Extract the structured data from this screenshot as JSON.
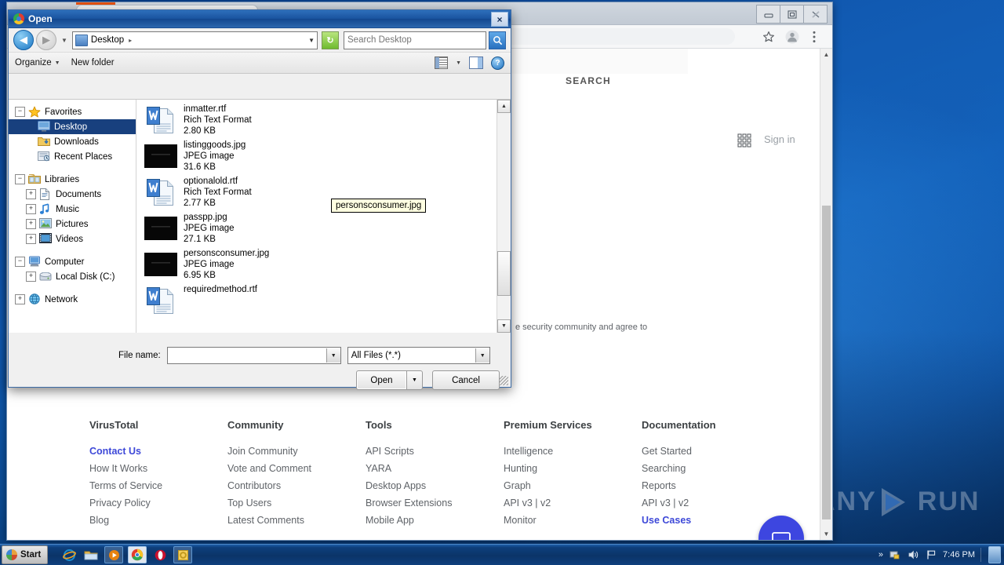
{
  "desktop": {
    "watermark": "ANY RUN",
    "watermark_left": "ANY",
    "watermark_right": "RUN"
  },
  "browser": {
    "window_controls": [
      "minimize",
      "maximize",
      "close"
    ],
    "toolbar_icons": [
      "star-icon",
      "avatar-icon",
      "menu-icon"
    ]
  },
  "vt_page": {
    "search_label": "SEARCH",
    "sign_in": "Sign in",
    "agree_text": "e security community and agree to",
    "footer": {
      "columns": [
        {
          "title": "VirusTotal",
          "links": [
            {
              "label": "Contact Us",
              "highlight": true
            },
            {
              "label": "How It Works",
              "highlight": false
            },
            {
              "label": "Terms of Service",
              "highlight": false
            },
            {
              "label": "Privacy Policy",
              "highlight": false
            },
            {
              "label": "Blog",
              "highlight": false
            }
          ]
        },
        {
          "title": "Community",
          "links": [
            {
              "label": "Join Community",
              "highlight": false
            },
            {
              "label": "Vote and Comment",
              "highlight": false
            },
            {
              "label": "Contributors",
              "highlight": false
            },
            {
              "label": "Top Users",
              "highlight": false
            },
            {
              "label": "Latest Comments",
              "highlight": false
            }
          ]
        },
        {
          "title": "Tools",
          "links": [
            {
              "label": "API Scripts",
              "highlight": false
            },
            {
              "label": "YARA",
              "highlight": false
            },
            {
              "label": "Desktop Apps",
              "highlight": false
            },
            {
              "label": "Browser Extensions",
              "highlight": false
            },
            {
              "label": "Mobile App",
              "highlight": false
            }
          ]
        },
        {
          "title": "Premium Services",
          "links": [
            {
              "label": "Intelligence",
              "highlight": false
            },
            {
              "label": "Hunting",
              "highlight": false
            },
            {
              "label": "Graph",
              "highlight": false
            },
            {
              "label": "API v3 | v2",
              "highlight": false
            },
            {
              "label": "Monitor",
              "highlight": false
            }
          ]
        },
        {
          "title": "Documentation",
          "links": [
            {
              "label": "Get Started",
              "highlight": false
            },
            {
              "label": "Searching",
              "highlight": false
            },
            {
              "label": "Reports",
              "highlight": false
            },
            {
              "label": "API v3 | v2",
              "highlight": false
            },
            {
              "label": "Use Cases",
              "highlight": true
            }
          ]
        }
      ]
    }
  },
  "dialog": {
    "title": "Open",
    "close_label": "×",
    "address": {
      "crumb": "Desktop",
      "crumb_arrow": "▸",
      "dropdown": "▼",
      "refresh": "↻"
    },
    "search": {
      "placeholder": "Search Desktop",
      "value": ""
    },
    "toolbar": {
      "organize": "Organize",
      "new_folder": "New folder",
      "caret": "▼"
    },
    "tree": [
      {
        "label": "Favorites",
        "expander": "−",
        "icon": "star-icon",
        "indent": 0,
        "selected": false
      },
      {
        "label": "Desktop",
        "expander": "",
        "icon": "desktop-icon",
        "indent": 1,
        "selected": true
      },
      {
        "label": "Downloads",
        "expander": "",
        "icon": "downloads-icon",
        "indent": 1,
        "selected": false
      },
      {
        "label": "Recent Places",
        "expander": "",
        "icon": "recent-icon",
        "indent": 1,
        "selected": false
      },
      {
        "label": "Libraries",
        "expander": "−",
        "icon": "libraries-icon",
        "indent": 0,
        "selected": false,
        "gap_before": true
      },
      {
        "label": "Documents",
        "expander": "+",
        "icon": "documents-icon",
        "indent": 1,
        "selected": false
      },
      {
        "label": "Music",
        "expander": "+",
        "icon": "music-icon",
        "indent": 1,
        "selected": false
      },
      {
        "label": "Pictures",
        "expander": "+",
        "icon": "pictures-icon",
        "indent": 1,
        "selected": false
      },
      {
        "label": "Videos",
        "expander": "+",
        "icon": "videos-icon",
        "indent": 1,
        "selected": false
      },
      {
        "label": "Computer",
        "expander": "−",
        "icon": "computer-icon",
        "indent": 0,
        "selected": false,
        "gap_before": true
      },
      {
        "label": "Local Disk (C:)",
        "expander": "+",
        "icon": "harddisk-icon",
        "indent": 1,
        "selected": false
      },
      {
        "label": "Network",
        "expander": "+",
        "icon": "network-icon",
        "indent": 0,
        "selected": false,
        "gap_before": true
      }
    ],
    "files": [
      {
        "name": "inmatter.rtf",
        "type": "Rich Text Format",
        "size": "2.80 KB",
        "icon": "rtf-doc-icon"
      },
      {
        "name": "listinggoods.jpg",
        "type": "JPEG image",
        "size": "31.6 KB",
        "icon": "jpeg-thumb-icon"
      },
      {
        "name": "optionalold.rtf",
        "type": "Rich Text Format",
        "size": "2.77 KB",
        "icon": "rtf-doc-icon"
      },
      {
        "name": "passpp.jpg",
        "type": "JPEG image",
        "size": "27.1 KB",
        "icon": "jpeg-thumb-icon"
      },
      {
        "name": "personsconsumer.jpg",
        "type": "JPEG image",
        "size": "6.95 KB",
        "icon": "jpeg-thumb-icon"
      },
      {
        "name": "requiredmethod.rtf",
        "type": "",
        "size": "",
        "icon": "rtf-doc-icon"
      }
    ],
    "tooltip": "personsconsumer.jpg",
    "filename_label": "File name:",
    "filename_value": "",
    "filetype_value": "All Files (*.*)",
    "open_button": "Open",
    "open_split_caret": "▼",
    "cancel_button": "Cancel"
  },
  "taskbar": {
    "start_label": "Start",
    "quicklaunch": [
      "internet-explorer-icon",
      "explorer-icon",
      "media-player-icon",
      "chrome-icon",
      "opera-icon",
      "office-icon"
    ],
    "tray": {
      "overflow": "»",
      "icons": [
        "network-tray-icon",
        "volume-tray-icon",
        "flag-tray-icon"
      ],
      "clock": "7:46 PM"
    }
  }
}
